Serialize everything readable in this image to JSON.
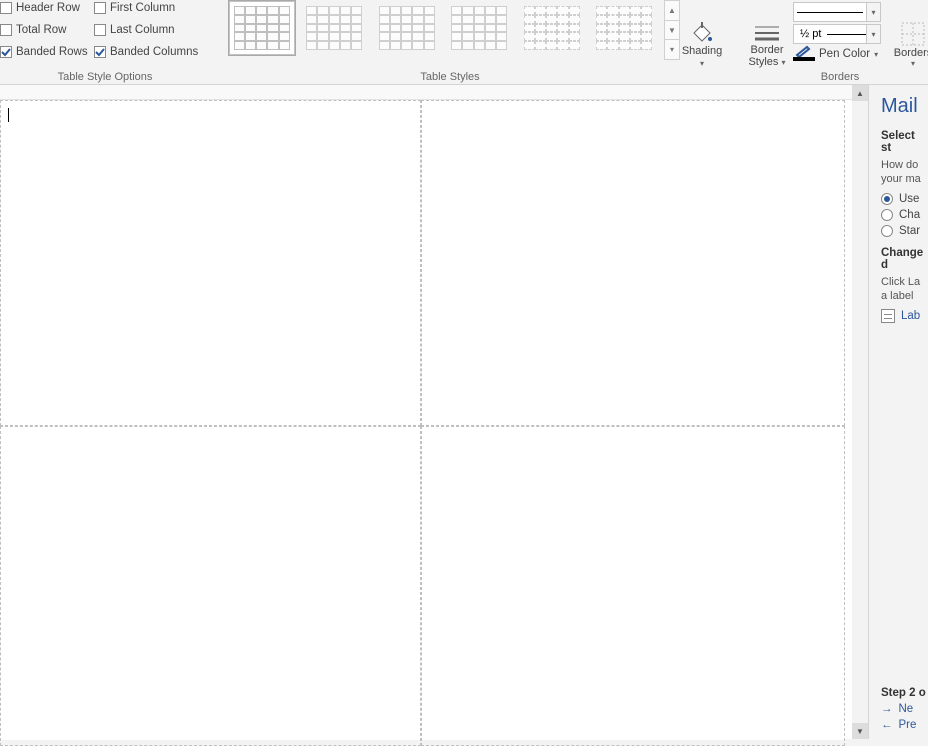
{
  "ribbon": {
    "options": {
      "header_row": "Header Row",
      "total_row": "Total Row",
      "banded_rows": "Banded Rows",
      "first_col": "First Column",
      "last_col": "Last Column",
      "banded_cols": "Banded Columns",
      "group_label": "Table Style Options",
      "checked": {
        "header_row": false,
        "total_row": false,
        "banded_rows": true,
        "first_col": false,
        "last_col": false,
        "banded_cols": true
      }
    },
    "styles": {
      "group_label": "Table Styles"
    },
    "shading": {
      "label": "Shading"
    },
    "borders": {
      "styles_label_1": "Border",
      "styles_label_2": "Styles",
      "weight": "½ pt",
      "pen_color": "Pen Color",
      "borders_label": "Borders",
      "group_label": "Borders"
    }
  },
  "pane": {
    "title": "Mail",
    "select_heading": "Select st",
    "select_help": "How do\nyour ma",
    "radios": {
      "use": "Use",
      "change": "Cha",
      "start": "Star"
    },
    "change_heading": "Change d",
    "change_help": "Click La\na label",
    "label_link": "Lab",
    "step_heading": "Step 2 o",
    "next": "Ne",
    "prev": "Pre"
  }
}
